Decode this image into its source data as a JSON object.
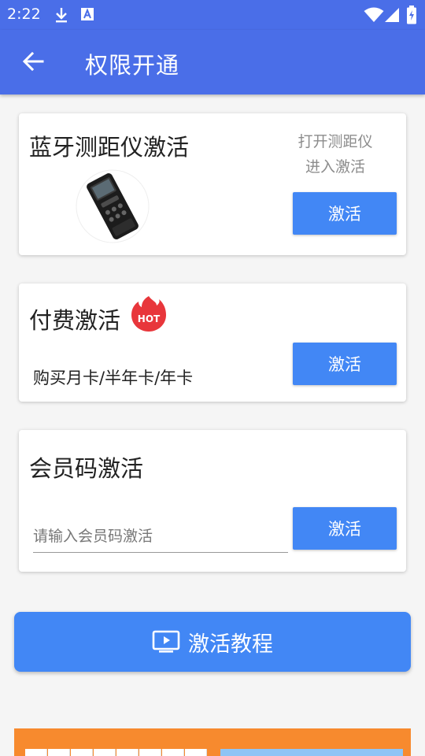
{
  "status_bar": {
    "time": "2:22",
    "icons": [
      "download-icon",
      "a-badge-icon",
      "wifi-icon",
      "signal-icon",
      "battery-icon"
    ]
  },
  "app_bar": {
    "back_icon": "arrow-left-icon",
    "title": "权限开通"
  },
  "cards": {
    "bluetooth": {
      "title": "蓝牙测距仪激活",
      "hint_line1": "打开测距仪",
      "hint_line2": "进入激活",
      "button": "激活",
      "image": "laser-rangefinder-device"
    },
    "paid": {
      "title": "付费激活",
      "badge": "HOT",
      "subtext": "购买月卡/半年卡/年卡",
      "button": "激活"
    },
    "member_code": {
      "title": "会员码激活",
      "input_placeholder": "请输入会员码激活",
      "input_value": "",
      "button": "激活"
    }
  },
  "tutorial": {
    "icon": "play-screen-icon",
    "label": "激活教程"
  },
  "colors": {
    "primary": "#4a6ee8",
    "button": "#4287f5",
    "ad_bg": "#f78a2e",
    "hot_badge": "#e8363b"
  }
}
